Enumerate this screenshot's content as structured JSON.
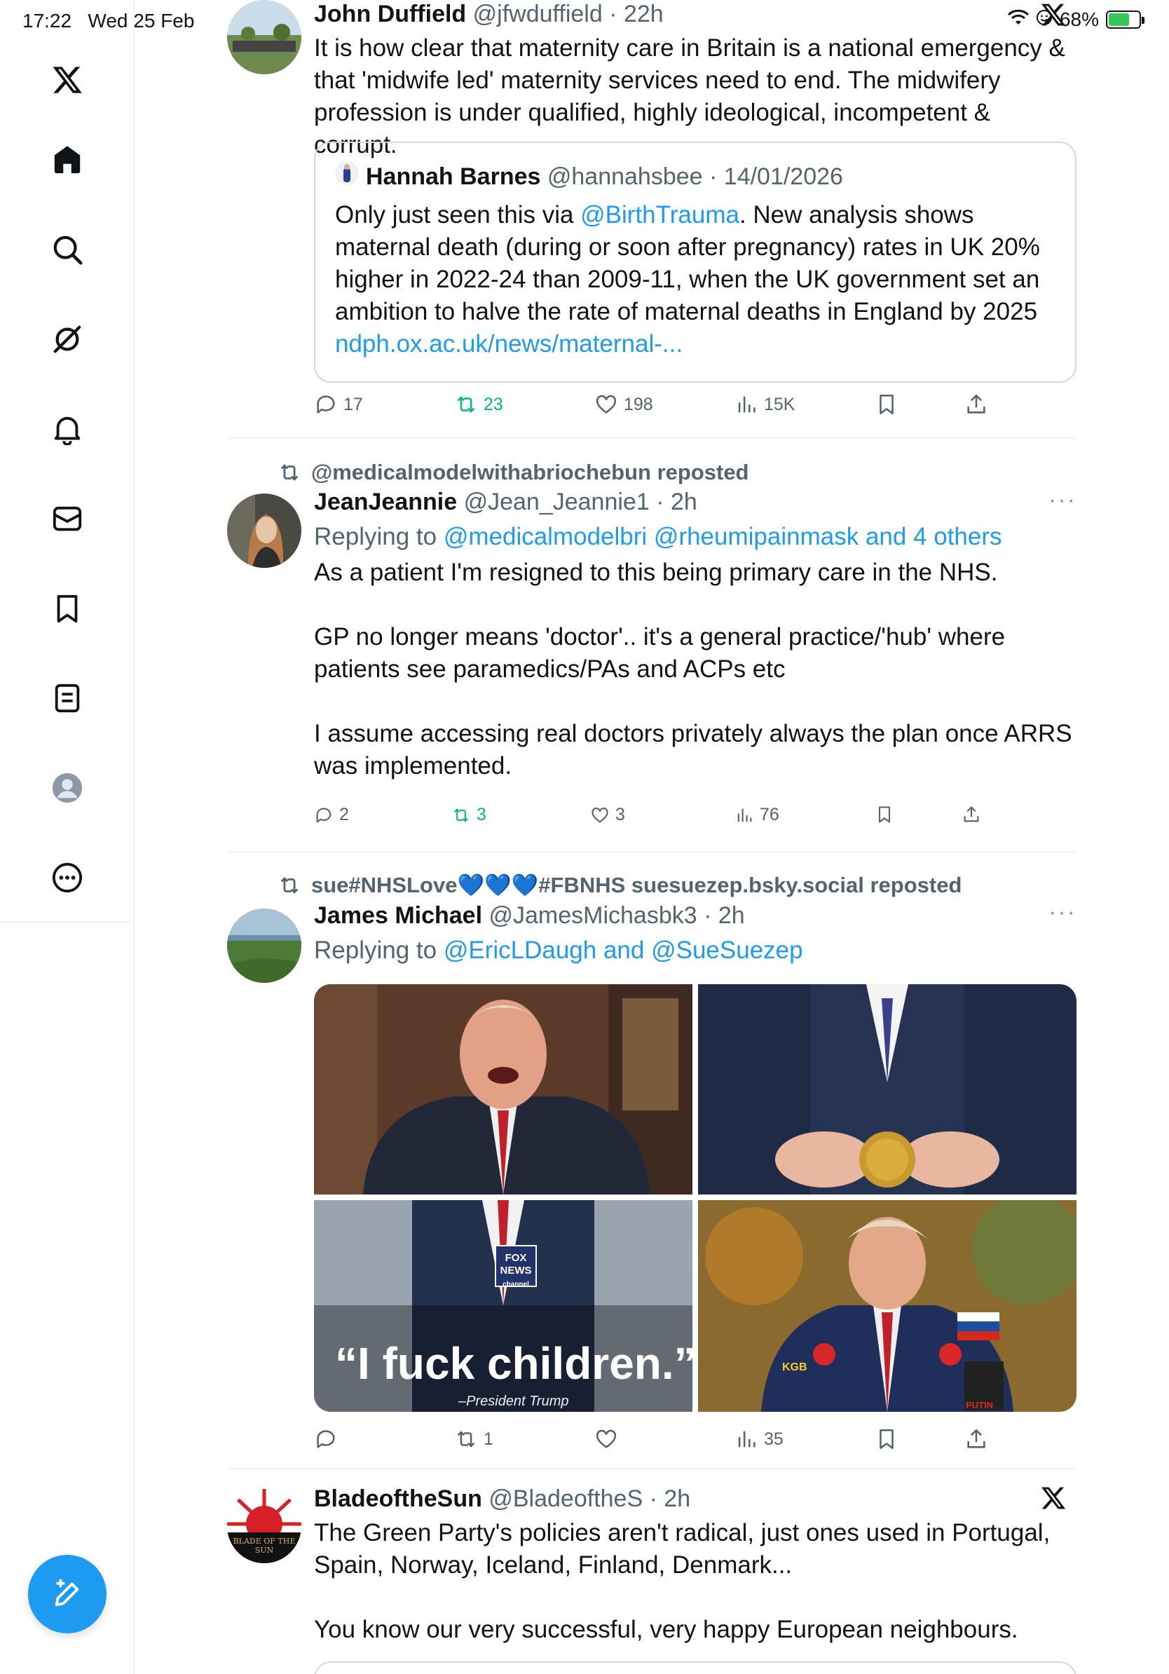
{
  "status_bar": {
    "time": "17:22",
    "date": "Wed 25 Feb",
    "battery": "68%",
    "battery_level": 0.68
  },
  "sidebar": {
    "items": [
      "x-logo",
      "home",
      "search",
      "grok",
      "notifications",
      "messages",
      "bookmarks",
      "lists",
      "profile",
      "more"
    ]
  },
  "tweets": [
    {
      "name": "John Duffield",
      "handle": "@jfwduffield",
      "time": "22h",
      "text": "It is how clear that maternity care in Britain is a national emergency & that 'midwife led' maternity services need to end. The midwifery profession is under qualified, highly ideological, incompetent & corrupt.",
      "quote": {
        "name": "Hannah Barnes",
        "handle": "@hannahsbee",
        "date": "14/01/2026",
        "text_pre": "Only just seen this via ",
        "mention": "@BirthTrauma",
        "text_post": ". New analysis shows maternal death (during or soon after pregnancy) rates in UK 20% higher in 2022-24 than 2009-11, when the UK government set an ambition to halve the rate of maternal deaths in England by 2025",
        "link": "ndph.ox.ac.uk/news/maternal-..."
      },
      "actions": {
        "replies": "17",
        "reposts": "23",
        "likes": "198",
        "views": "15K"
      }
    },
    {
      "reposted_by": "@medicalmodelwithabriochebun reposted",
      "name": "JeanJeannie",
      "handle": "@Jean_Jeannie1",
      "time": "2h",
      "replying_prefix": "Replying to ",
      "replying_to": "@medicalmodelbri @rheumipainmask and 4 others",
      "text_p1": "As a patient I'm resigned to this being primary care in the NHS.",
      "text_p2": "GP no longer means 'doctor'.. it's a general practice/'hub' where patients see paramedics/PAs and ACPs etc",
      "text_p3": "I assume accessing real doctors privately always the plan once ARRS was implemented.",
      "actions": {
        "replies": "2",
        "reposts": "3",
        "likes": "3",
        "views": "76"
      }
    },
    {
      "reposted_by": "sue#NHSLove💙💙💙#FBNHS suesuezep.bsky.social reposted",
      "name": "James Michael",
      "handle": "@JamesMichasbk3",
      "time": "2h",
      "replying_prefix": "Replying to ",
      "replying_to": "@EricLDaugh and @SueSuezep",
      "media_caption": "“I fuck children.”",
      "media_caption_sub": "–President Trump",
      "media_badge": "FOX NEWS",
      "media_badge_sub": "channel",
      "media_patch_1": "KGB",
      "media_patch_2": "PUTIN",
      "actions": {
        "replies": "",
        "reposts": "1",
        "likes": "",
        "views": "35"
      }
    },
    {
      "name": "BladeoftheSun",
      "handle": "@BladeoftheS",
      "time": "2h",
      "avatar_text": "BLADE OF THE SUN",
      "text_p1": "The Green Party's policies aren't radical, just ones used in Portugal, Spain, Norway, Iceland, Finland, Denmark...",
      "text_p2": "You know our very successful, very happy European neighbours."
    }
  ],
  "colors": {
    "accent": "#1d9bf0",
    "repost_green": "#00ba7c",
    "secondary_text": "#536471"
  }
}
